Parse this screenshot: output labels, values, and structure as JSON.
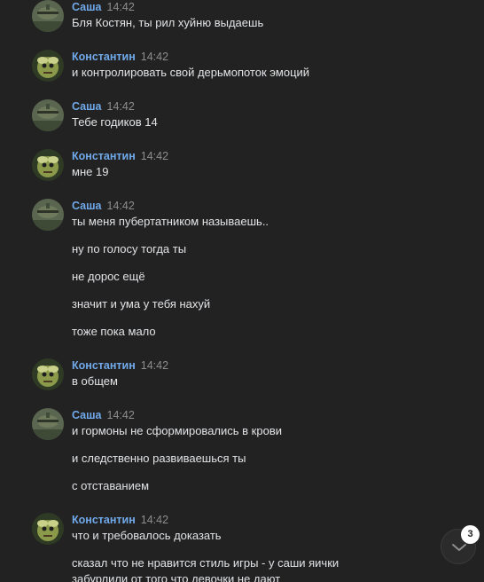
{
  "messages": [
    {
      "author": "Саша",
      "time": "14:42",
      "lines": [
        "Бля Костян, ты рил хуйню выдаешь"
      ]
    },
    {
      "author": "Константин",
      "time": "14:42",
      "lines": [
        "и контролировать свой дерьмопоток эмоций"
      ]
    },
    {
      "author": "Саша",
      "time": "14:42",
      "lines": [
        "Тебе годиков 14"
      ]
    },
    {
      "author": "Константин",
      "time": "14:42",
      "lines": [
        "мне 19"
      ]
    },
    {
      "author": "Саша",
      "time": "14:42",
      "lines": [
        "ты меня пубертатником называешь..",
        "ну по голосу тогда ты",
        "не дорос ещё",
        "значит и ума у тебя нахуй",
        "тоже пока мало"
      ]
    },
    {
      "author": "Константин",
      "time": "14:42",
      "lines": [
        "в общем"
      ]
    },
    {
      "author": "Саша",
      "time": "14:42",
      "lines": [
        "и гормоны не сформировались в крови",
        "и следственно развиваешься ты",
        "с отставанием"
      ]
    },
    {
      "author": "Константин",
      "time": "14:42",
      "lines": [
        "что и требовалось доказать",
        "сказал что не нравится стиль игры - у саши яички",
        "забурлили от того что девочки не дают"
      ]
    }
  ],
  "scroll_button": {
    "icon": "chevron-down-icon",
    "unread_count": "3"
  },
  "colors": {
    "background": "#222222",
    "author": "#71aaeb",
    "time": "#8e8e8e",
    "text": "#e1e3e6"
  }
}
